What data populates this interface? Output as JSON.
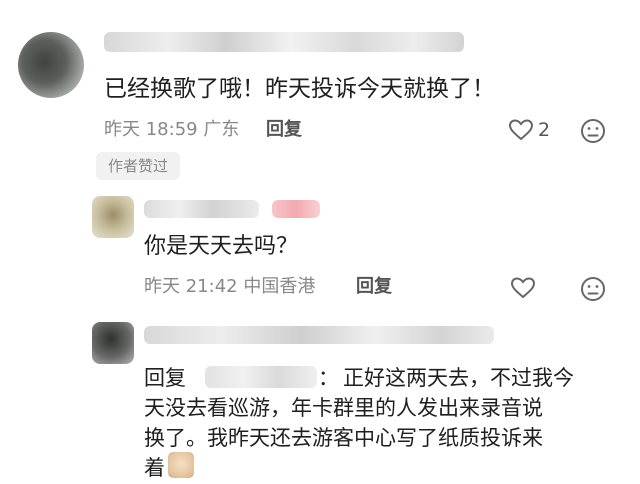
{
  "comment1": {
    "text": "已经换歌了哦！昨天投诉今天就换了！",
    "meta": {
      "time": "昨天 18:59",
      "location": "广东",
      "reply_label": "回复",
      "likes": "2"
    },
    "badge": "作者赞过"
  },
  "comment2": {
    "text": "你是天天去吗？",
    "meta": {
      "time": "昨天 21:42",
      "location": "中国香港",
      "reply_label": "回复"
    }
  },
  "comment3": {
    "reply_prefix": "回复",
    "separator": "：",
    "line1": "正好这两天去，不过我今",
    "line2": "天没去看巡游，年卡群里的人发出来录音说",
    "line3": "换了。我昨天还去游客中心写了纸质投诉来",
    "line4": "着"
  },
  "icons": {
    "like": "heart-outline-icon",
    "dislike": "frown-face-icon",
    "emoji": "sticker-emoji-icon"
  }
}
